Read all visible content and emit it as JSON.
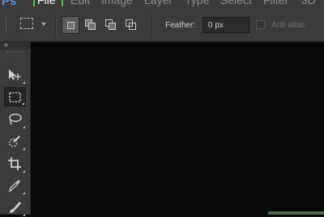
{
  "app": {
    "logo": "Ps"
  },
  "menu": {
    "items": [
      {
        "label": "File"
      },
      {
        "label": "Edit"
      },
      {
        "label": "Image"
      },
      {
        "label": "Layer"
      },
      {
        "label": "Type"
      },
      {
        "label": "Select"
      },
      {
        "label": "Filter"
      },
      {
        "label": "3D"
      }
    ],
    "highlighted": "File"
  },
  "options_bar": {
    "feather_label": "Feather:",
    "feather_value": "0 px",
    "anti_alias_label": "Anti-alias",
    "anti_alias_checked": false,
    "selection_mode_active": "new-selection"
  },
  "toolbar": {
    "collapse_glyph": "»",
    "tools": [
      {
        "icon": "move-tool-icon"
      },
      {
        "icon": "rectangular-marquee-tool-icon",
        "selected": true
      },
      {
        "icon": "lasso-tool-icon"
      },
      {
        "icon": "quick-selection-tool-icon"
      },
      {
        "icon": "crop-tool-icon"
      },
      {
        "icon": "eyedropper-tool-icon"
      },
      {
        "icon": "brush-tool-icon"
      }
    ]
  },
  "colors": {
    "highlight": "#35d23a",
    "panel": "#3b3b3b",
    "canvas": "#080808",
    "logo": "#4a9be0"
  }
}
